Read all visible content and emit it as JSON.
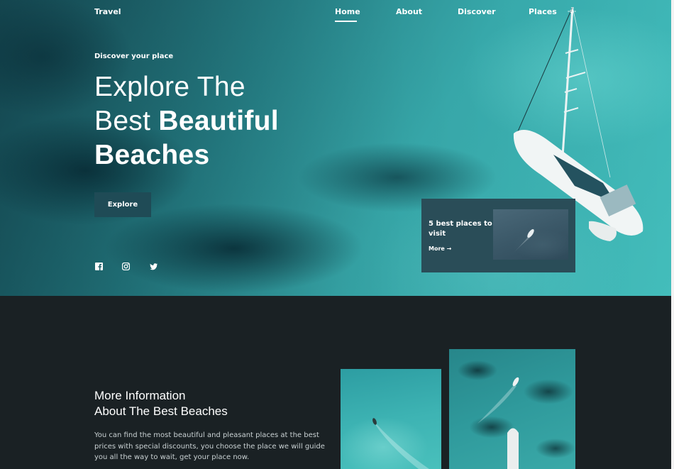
{
  "nav": {
    "brand": "Travel",
    "links": [
      "Home",
      "About",
      "Discover",
      "Places"
    ],
    "active": "Home",
    "theme_icon": "sun-icon"
  },
  "hero": {
    "eyebrow": "Discover your place",
    "headline_line1": "Explore The",
    "headline_line2_light": "Best",
    "headline_line2_bold": "Beautiful",
    "headline_line3_bold": "Beaches",
    "button_label": "Explore",
    "social_icons": [
      "facebook-icon",
      "instagram-icon",
      "twitter-icon"
    ]
  },
  "card": {
    "title": "5 best places to visit",
    "more_label": "More"
  },
  "info": {
    "title_line1": "More Information",
    "title_line2": "About The Best Beaches",
    "body": "You can find the most beautiful and pleasant places at the best prices with special discounts, you choose the place we will guide you all the way to wait, get your place now."
  },
  "colors": {
    "hero_water": "#39aeb0",
    "dark_bg": "#1a2124",
    "button_bg": "#1f4b56",
    "card_bg": "#2a4d58"
  }
}
